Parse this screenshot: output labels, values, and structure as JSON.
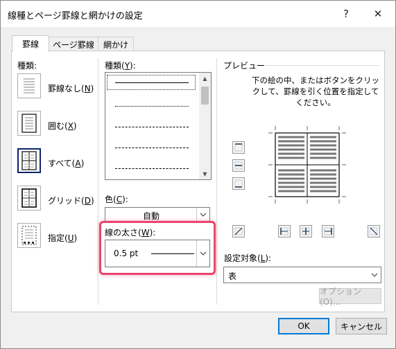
{
  "window": {
    "title": "線種とページ罫線と網かけの設定",
    "help_glyph": "?",
    "close_glyph": "✕"
  },
  "tabs": [
    {
      "label": "罫線"
    },
    {
      "label": "ページ罫線"
    },
    {
      "label": "網かけ"
    }
  ],
  "setting": {
    "heading": "種類:",
    "items": [
      {
        "label": "罫線なし(",
        "key": "N",
        "tail": ")"
      },
      {
        "label": "囲む(",
        "key": "X",
        "tail": ")"
      },
      {
        "label": "すべて(",
        "key": "A",
        "tail": ")"
      },
      {
        "label": "グリッド(",
        "key": "D",
        "tail": ")"
      },
      {
        "label": "指定(",
        "key": "U",
        "tail": ")"
      }
    ],
    "selected": "すべて"
  },
  "style": {
    "label": "種類(",
    "key": "Y",
    "tail": "):"
  },
  "color": {
    "label": "色(",
    "key": "C",
    "tail": "):",
    "value": "自動"
  },
  "width": {
    "label": "線の太さ(",
    "key": "W",
    "tail": "):",
    "value": "0.5 pt"
  },
  "preview": {
    "heading": "プレビュー",
    "instructions": "下の絵の中、またはボタンをクリックして、罫線を引く位置を指定してください。"
  },
  "apply_to": {
    "label": "設定対象(",
    "key": "L",
    "tail": "):",
    "value": "表"
  },
  "buttons": {
    "options": "オプション(O)...",
    "ok": "OK",
    "cancel": "キャンセル"
  },
  "colors": {
    "highlight": "#e8456e",
    "primary_border": "#0078d7"
  }
}
